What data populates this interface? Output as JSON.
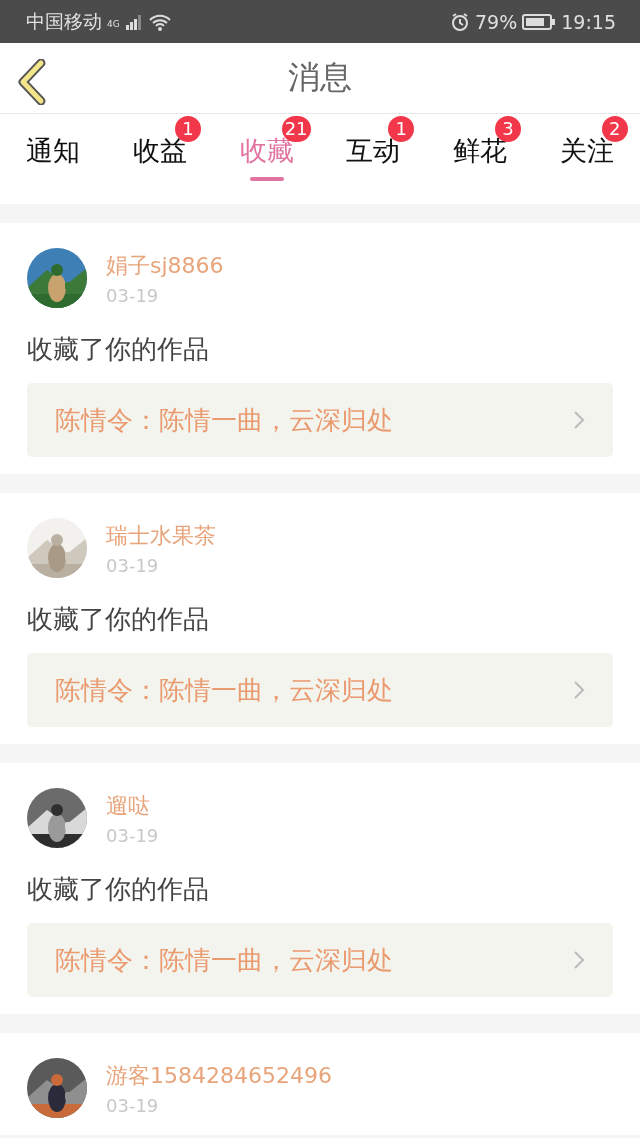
{
  "status_bar": {
    "carrier": "中国移动",
    "network": "4G",
    "battery": "79%",
    "time": "19:15"
  },
  "header": {
    "title": "消息"
  },
  "tabs": [
    {
      "label": "通知",
      "selected": false
    },
    {
      "label": "收益",
      "selected": false,
      "badge": "1"
    },
    {
      "label": "收藏",
      "selected": true,
      "badge": "21"
    },
    {
      "label": "互动",
      "selected": false,
      "badge": "1"
    },
    {
      "label": "鲜花",
      "selected": false,
      "badge": "3"
    },
    {
      "label": "关注",
      "selected": false,
      "badge": "2"
    }
  ],
  "messages": [
    {
      "name": "娟子sj8866",
      "date": "03-19",
      "action": "收藏了你的作品",
      "work": "陈情令：陈情一曲，云深归处"
    },
    {
      "name": "瑞士水果茶",
      "date": "03-19",
      "action": "收藏了你的作品",
      "work": "陈情令：陈情一曲，云深归处"
    },
    {
      "name": "遛哒",
      "date": "03-19",
      "action": "收藏了你的作品",
      "work": "陈情令：陈情一曲，云深归处"
    },
    {
      "name": "游客1584284652496",
      "date": "03-19"
    }
  ]
}
